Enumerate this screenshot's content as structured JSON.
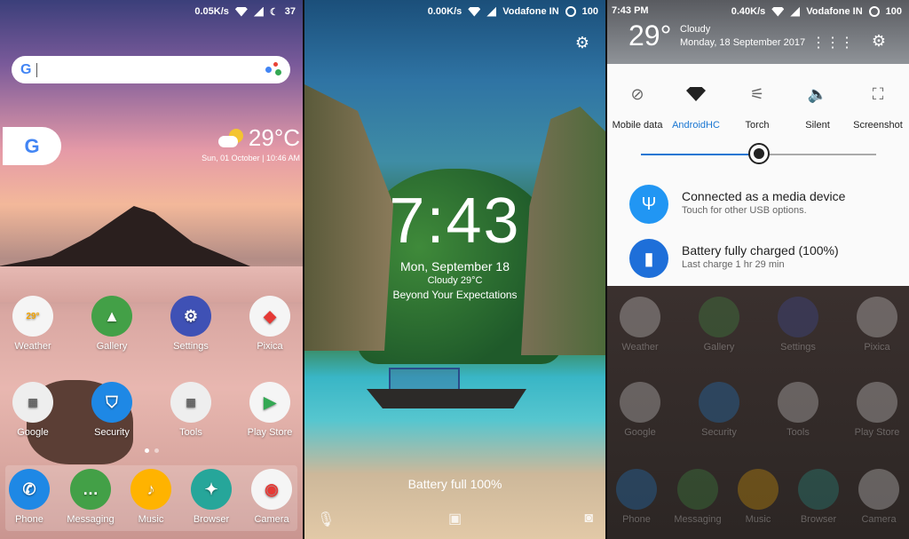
{
  "home": {
    "status": {
      "speed": "0.05K/s",
      "battery": "37"
    },
    "weather": {
      "temp": "29°C",
      "date": "Sun, 01 October | 10:46 AM"
    },
    "apps_row1": [
      {
        "label": "Weather",
        "color": "#f5f5f5"
      },
      {
        "label": "Gallery",
        "color": "#43a047"
      },
      {
        "label": "Settings",
        "color": "#3f51b5"
      },
      {
        "label": "Pixica",
        "color": "#f5f5f5"
      }
    ],
    "apps_row2": [
      {
        "label": "Google",
        "color": "#eeeeee"
      },
      {
        "label": "Security",
        "color": "#1e88e5"
      },
      {
        "label": "Tools",
        "color": "#eeeeee"
      },
      {
        "label": "Play Store",
        "color": "#f5f5f5"
      }
    ],
    "dock": [
      {
        "label": "Phone",
        "color": "#1e88e5"
      },
      {
        "label": "Messaging",
        "color": "#43a047"
      },
      {
        "label": "Music",
        "color": "#ffb300"
      },
      {
        "label": "Browser",
        "color": "#26a69a"
      },
      {
        "label": "Camera",
        "color": "#f5f5f5"
      }
    ],
    "weather_icon_temp": "29°"
  },
  "lock": {
    "status": {
      "speed": "0.00K/s",
      "carrier": "Vodafone IN",
      "battery": "100"
    },
    "time": "7:43",
    "date": "Mon, September 18",
    "weather": "Cloudy 29°C",
    "tagline": "Beyond Your Expectations",
    "battery_message": "Battery full 100%"
  },
  "shade": {
    "status": {
      "time": "7:43 PM",
      "speed": "0.40K/s",
      "carrier": "Vodafone IN",
      "battery": "100"
    },
    "temp": "29°",
    "condition": "Cloudy",
    "date": "Monday, 18 September 2017",
    "tiles": [
      {
        "label": "Mobile data"
      },
      {
        "label": "AndroidHC"
      },
      {
        "label": "Torch"
      },
      {
        "label": "Silent"
      },
      {
        "label": "Screenshot"
      }
    ],
    "brightness": 0.5,
    "notifications": [
      {
        "title": "Connected as a media device",
        "subtitle": "Touch for other USB options.",
        "color": "#2196f3"
      },
      {
        "title": "Battery fully charged (100%)",
        "subtitle": "Last charge 1 hr 29 min",
        "color": "#1e6fd9"
      }
    ]
  }
}
